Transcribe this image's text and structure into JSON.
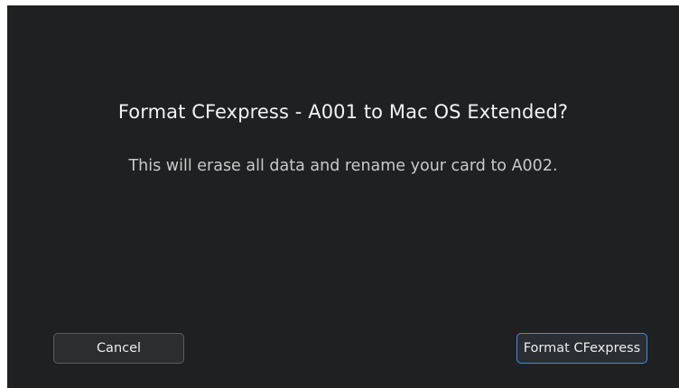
{
  "dialog": {
    "title": "Format CFexpress - A001 to Mac OS Extended?",
    "message": "This will erase all data and rename your card to A002.",
    "cancel_label": "Cancel",
    "confirm_label": "Format CFexpress"
  },
  "colors": {
    "background": "#1f2021",
    "focus_accent": "#3e8fe0",
    "button_border": "#5c5e62"
  }
}
